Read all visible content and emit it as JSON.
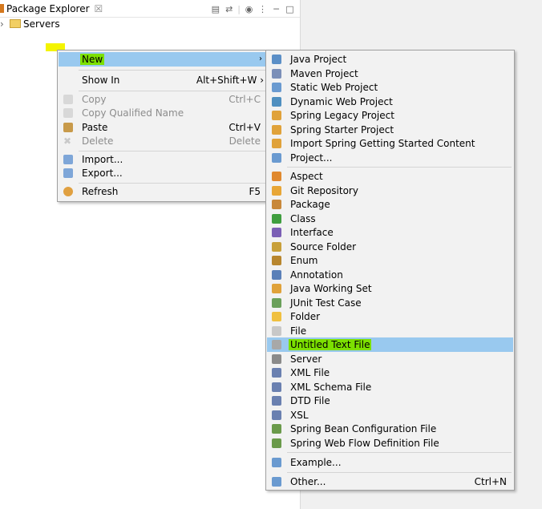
{
  "explorer": {
    "title": "Package Explorer",
    "close_glyph": "☒",
    "tree": [
      {
        "label": "Servers",
        "icon": "folder-icon"
      }
    ]
  },
  "context_menu": {
    "new_label": "New",
    "show_in_label": "Show In",
    "show_in_shortcut": "Alt+Shift+W ›",
    "copy_label": "Copy",
    "copy_shortcut": "Ctrl+C",
    "copy_qualified_label": "Copy Qualified Name",
    "paste_label": "Paste",
    "paste_shortcut": "Ctrl+V",
    "delete_label": "Delete",
    "delete_shortcut": "Delete",
    "import_label": "Import...",
    "export_label": "Export...",
    "refresh_label": "Refresh",
    "refresh_shortcut": "F5"
  },
  "submenu": {
    "items": [
      {
        "label": "Java Project",
        "icon": "java-project-icon",
        "color": "#5b8fc7"
      },
      {
        "label": "Maven Project",
        "icon": "maven-project-icon",
        "color": "#7b8fb8"
      },
      {
        "label": "Static Web Project",
        "icon": "static-web-project-icon",
        "color": "#6a9ad0"
      },
      {
        "label": "Dynamic Web Project",
        "icon": "dynamic-web-project-icon",
        "color": "#4f8fc0"
      },
      {
        "label": "Spring Legacy Project",
        "icon": "spring-legacy-project-icon",
        "color": "#e0a23a"
      },
      {
        "label": "Spring Starter Project",
        "icon": "spring-starter-project-icon",
        "color": "#e0a23a"
      },
      {
        "label": "Import Spring Getting Started Content",
        "icon": "spring-import-icon",
        "color": "#e0a23a"
      },
      {
        "label": "Project...",
        "icon": "project-icon",
        "color": "#6a9ad0"
      },
      {
        "label": "Aspect",
        "icon": "aspect-icon",
        "color": "#e0892f"
      },
      {
        "label": "Git Repository",
        "icon": "git-repository-icon",
        "color": "#e8a636"
      },
      {
        "label": "Package",
        "icon": "package-icon",
        "color": "#c8883a"
      },
      {
        "label": "Class",
        "icon": "class-icon",
        "color": "#3f9e3f"
      },
      {
        "label": "Interface",
        "icon": "interface-icon",
        "color": "#7b5fb5"
      },
      {
        "label": "Source Folder",
        "icon": "source-folder-icon",
        "color": "#c8a03a"
      },
      {
        "label": "Enum",
        "icon": "enum-icon",
        "color": "#b8862e"
      },
      {
        "label": "Annotation",
        "icon": "annotation-icon",
        "color": "#5a80b8"
      },
      {
        "label": "Java Working Set",
        "icon": "working-set-icon",
        "color": "#e0a23a"
      },
      {
        "label": "JUnit Test Case",
        "icon": "junit-test-icon",
        "color": "#6aa05a"
      },
      {
        "label": "Folder",
        "icon": "folder-icon",
        "color": "#f0c040"
      },
      {
        "label": "File",
        "icon": "file-icon",
        "color": "#c8c8c8"
      },
      {
        "label": "Untitled Text File",
        "icon": "text-file-icon",
        "color": "#a8a8a8"
      },
      {
        "label": "Server",
        "icon": "server-icon",
        "color": "#8a8a8a"
      },
      {
        "label": "XML File",
        "icon": "xml-file-icon",
        "color": "#6a80b0"
      },
      {
        "label": "XML Schema File",
        "icon": "xml-schema-icon",
        "color": "#6a80b0"
      },
      {
        "label": "DTD File",
        "icon": "dtd-file-icon",
        "color": "#6a80b0"
      },
      {
        "label": "XSL",
        "icon": "xsl-icon",
        "color": "#6a80b0"
      },
      {
        "label": "Spring Bean Configuration File",
        "icon": "spring-bean-icon",
        "color": "#6a9a4a"
      },
      {
        "label": "Spring Web Flow Definition File",
        "icon": "spring-webflow-icon",
        "color": "#6a9a4a"
      },
      {
        "label": "Example...",
        "icon": "example-icon",
        "color": "#6a9ad0"
      },
      {
        "label": "Other...",
        "icon": "other-icon",
        "color": "#6a9ad0",
        "shortcut": "Ctrl+N"
      }
    ]
  }
}
